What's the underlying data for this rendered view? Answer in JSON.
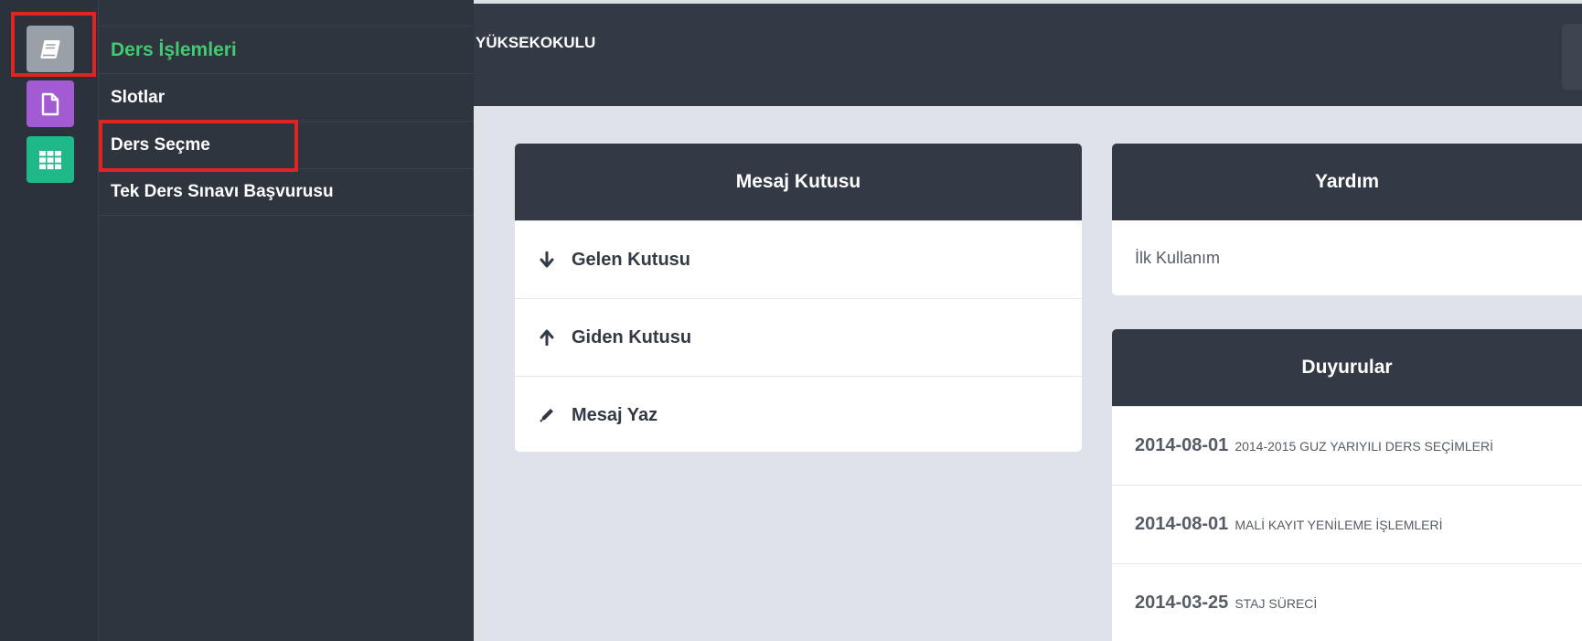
{
  "rail": {
    "items": [
      {
        "icon": "book-icon",
        "color": "#9aa0a7"
      },
      {
        "icon": "document-icon",
        "color": "#a35bd3"
      },
      {
        "icon": "grid-icon",
        "color": "#1fb889"
      }
    ]
  },
  "menu": {
    "items": [
      {
        "label": "Ders İşlemleri",
        "active": true
      },
      {
        "label": "Slotlar"
      },
      {
        "label": "Ders Seçme"
      },
      {
        "label": "Tek Ders Sınavı Başvurusu"
      }
    ],
    "active_color": "#43c972"
  },
  "header": {
    "title": "YÜKSEKOKULU"
  },
  "mailbox": {
    "title": "Mesaj Kutusu",
    "items": [
      {
        "label": "Gelen Kutusu",
        "icon": "arrow-down-icon"
      },
      {
        "label": "Giden Kutusu",
        "icon": "arrow-up-icon"
      },
      {
        "label": "Mesaj Yaz",
        "icon": "pencil-icon"
      }
    ]
  },
  "help": {
    "title": "Yardım",
    "items": [
      {
        "label": "İlk Kullanım"
      }
    ]
  },
  "announcements": {
    "title": "Duyurular",
    "items": [
      {
        "date": "2014-08-01",
        "text": "2014-2015 GUZ YARIYILI DERS SEÇİMLERİ"
      },
      {
        "date": "2014-08-01",
        "text": "MALİ KAYIT YENİLEME İŞLEMLERİ"
      },
      {
        "date": "2014-03-25",
        "text": "STAJ SÜRECİ"
      }
    ]
  },
  "colors": {
    "dark_bg": "#2e353f",
    "header_bg": "#333a45",
    "content_bg": "#dfe2e8",
    "highlight": "#e02424"
  }
}
